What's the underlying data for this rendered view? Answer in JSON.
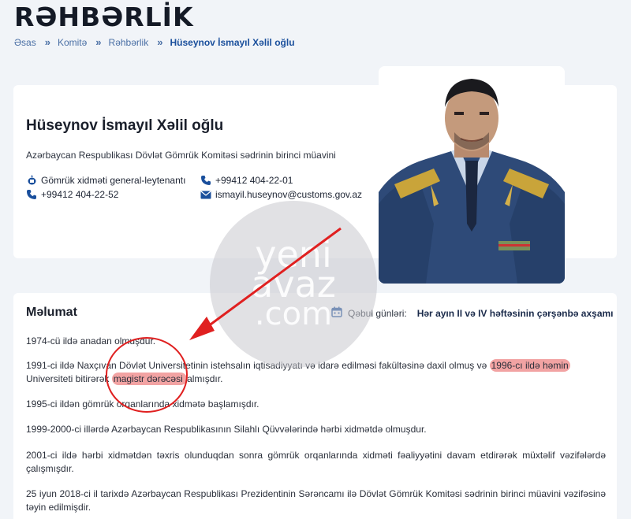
{
  "page": {
    "title": "RƏHBƏRLİK"
  },
  "breadcrumb": {
    "items": [
      "Əsas",
      "Komitə",
      "Rəhbərlik"
    ],
    "current": "Hüseynov İsmayıl Xəlil oğlu",
    "separator": "»"
  },
  "profile": {
    "name": "Hüseynov İsmayıl Xəlil oğlu",
    "position": "Azərbaycan Respublikası Dövlət Gömrük Komitəsi sədrinin birinci müavini",
    "rank": "Gömrük xidməti general-leytenantı",
    "phone1": "+99412 404-22-01",
    "phone2": "+99412 404-22-52",
    "email": "ismayil.huseynov@customs.gov.az"
  },
  "info": {
    "title": "Məlumat",
    "reception_label": "Qəbul günləri:",
    "reception_value": "Hər ayın II və IV həftəsinin çərşənbə axşamı",
    "bio": {
      "p1": "1974-cü ildə anadan olmuşdur.",
      "p2_a": "1991-ci ildə Naxçıvan Dövlət Universitetinin istehsalın iqtisadiyyatı və idarə edilməsi fakültəsinə daxil olmuş və ",
      "p2_b": "1996-cı ildə həmin",
      "p2_c": "Universiteti bitirərək ",
      "p2_d": "magistr dərəcəsi ",
      "p2_e": "almışdır.",
      "p3": "1995-ci ildən gömrük orqanlarında xidmətə başlamışdır.",
      "p4": "1999-2000-ci illərdə Azərbaycan Respublikasının Silahlı Qüvvələrində hərbi xidmətdə olmuşdur.",
      "p5": "2001-ci ildə hərbi xidmətdən təxris olunduqdan sonra gömrük orqanlarında xidməti fəaliyyətini davam etdirərək müxtəlif vəzifələrdə çalışmışdır.",
      "p6": "25 iyun 2018-ci il tarixdə Azərbaycan Respublikası Prezidentinin Sərəncamı ilə Dövlət Gömrük Komitəsi sədrinin birinci müavini vəzifəsinə təyin edilmişdir."
    }
  },
  "watermark": {
    "line1": "yeni",
    "line2": "avaz",
    "line3": ".com"
  },
  "colors": {
    "accent": "#1a4f9c",
    "highlight": "#f2a3a3",
    "annotation": "#e02020",
    "background": "#f1f4f8"
  },
  "icons": [
    "emblem-icon",
    "phone-icon",
    "phone-icon",
    "mail-icon",
    "calendar-icon"
  ]
}
